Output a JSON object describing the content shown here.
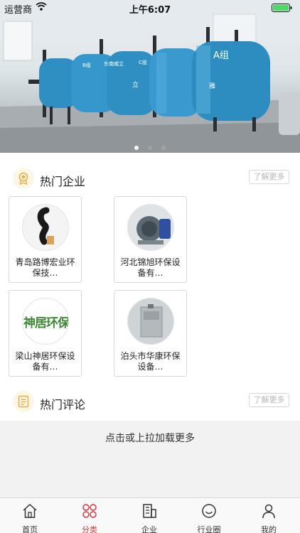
{
  "status_bar": {
    "carrier": "运营商",
    "time": "上午6:07"
  },
  "banner": {
    "slide_count": 3,
    "active_slide": 1,
    "signs": [
      "A组",
      "东南威立",
      "B组",
      "C组",
      "立",
      "雅"
    ]
  },
  "hot_companies": {
    "title": "热门企业",
    "more_label": "了解更多",
    "items": [
      {
        "name": "青岛路博宏业环保技…"
      },
      {
        "name": "河北锦旭环保设备有…"
      },
      {
        "name": "梁山神居环保设备有…",
        "logo_text": "神居环保"
      },
      {
        "name": "泊头市华康环保设备…"
      }
    ]
  },
  "hot_comments": {
    "title": "热门评论",
    "more_label": "了解更多"
  },
  "load_more": "点击或上拉加载更多",
  "tabbar": {
    "items": [
      {
        "label": "首页",
        "icon": "home-icon"
      },
      {
        "label": "分类",
        "icon": "category-icon",
        "active": true
      },
      {
        "label": "企业",
        "icon": "building-icon"
      },
      {
        "label": "行业圈",
        "icon": "circle-smile-icon"
      },
      {
        "label": "我的",
        "icon": "user-icon"
      }
    ]
  },
  "colors": {
    "accent": "#d23b3b",
    "gold": "#e1b04a",
    "tank_blue": "#2f8fc2"
  }
}
